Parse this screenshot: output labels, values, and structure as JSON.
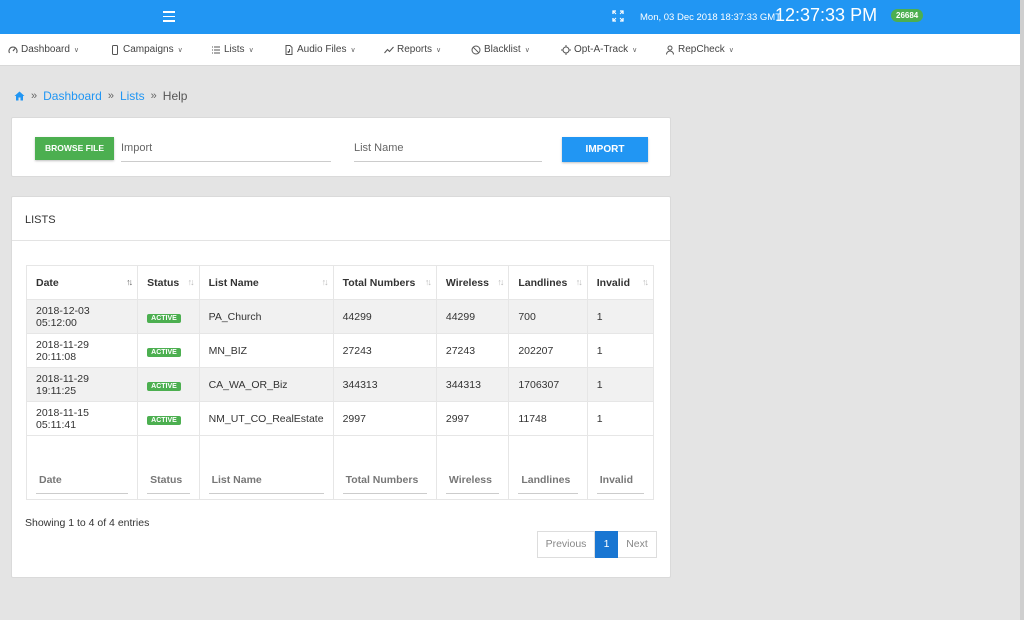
{
  "header": {
    "datetime": "Mon, 03 Dec 2018 18:37:33 GMT",
    "clock": "12:37:33 PM",
    "badge": "26684"
  },
  "nav": {
    "items": [
      {
        "label": "Dashboard",
        "icon": "gauge-icon"
      },
      {
        "label": "Campaigns",
        "icon": "phone-icon"
      },
      {
        "label": "Lists",
        "icon": "list-icon"
      },
      {
        "label": "Audio Files",
        "icon": "audio-file-icon"
      },
      {
        "label": "Reports",
        "icon": "chart-line-icon"
      },
      {
        "label": "Blacklist",
        "icon": "ban-icon"
      },
      {
        "label": "Opt-A-Track",
        "icon": "crosshair-icon"
      },
      {
        "label": "RepCheck",
        "icon": "user-check-icon"
      }
    ]
  },
  "breadcrumb": {
    "items": [
      "Dashboard",
      "Lists",
      "Help"
    ],
    "separator": "»"
  },
  "import_form": {
    "browse_label": "BROWSE FILE",
    "import_placeholder": "Import",
    "list_name_placeholder": "List Name",
    "import_button": "IMPORT"
  },
  "lists": {
    "title": "LISTS",
    "columns": [
      "Date",
      "Status",
      "List Name",
      "Total Numbers",
      "Wireless",
      "Landlines",
      "Invalid"
    ],
    "rows": [
      [
        "2018-12-03 05:12:00",
        "ACTIVE",
        "PA_Church",
        "44299",
        "44299",
        "700",
        "1"
      ],
      [
        "2018-11-29 20:11:08",
        "ACTIVE",
        "MN_BIZ",
        "27243",
        "27243",
        "202207",
        "1"
      ],
      [
        "2018-11-29 19:11:25",
        "ACTIVE",
        "CA_WA_OR_Biz",
        "344313",
        "344313",
        "1706307",
        "1"
      ],
      [
        "2018-11-15 05:11:41",
        "ACTIVE",
        "NM_UT_CO_RealEstate",
        "2997",
        "2997",
        "11748",
        "1"
      ]
    ],
    "showing": "Showing 1 to 4 of 4 entries",
    "pagination": {
      "previous": "Previous",
      "current": "1",
      "next": "Next"
    }
  },
  "colors": {
    "topbar": "#2196f3",
    "success": "#4caf50",
    "link": "#2196f3"
  }
}
